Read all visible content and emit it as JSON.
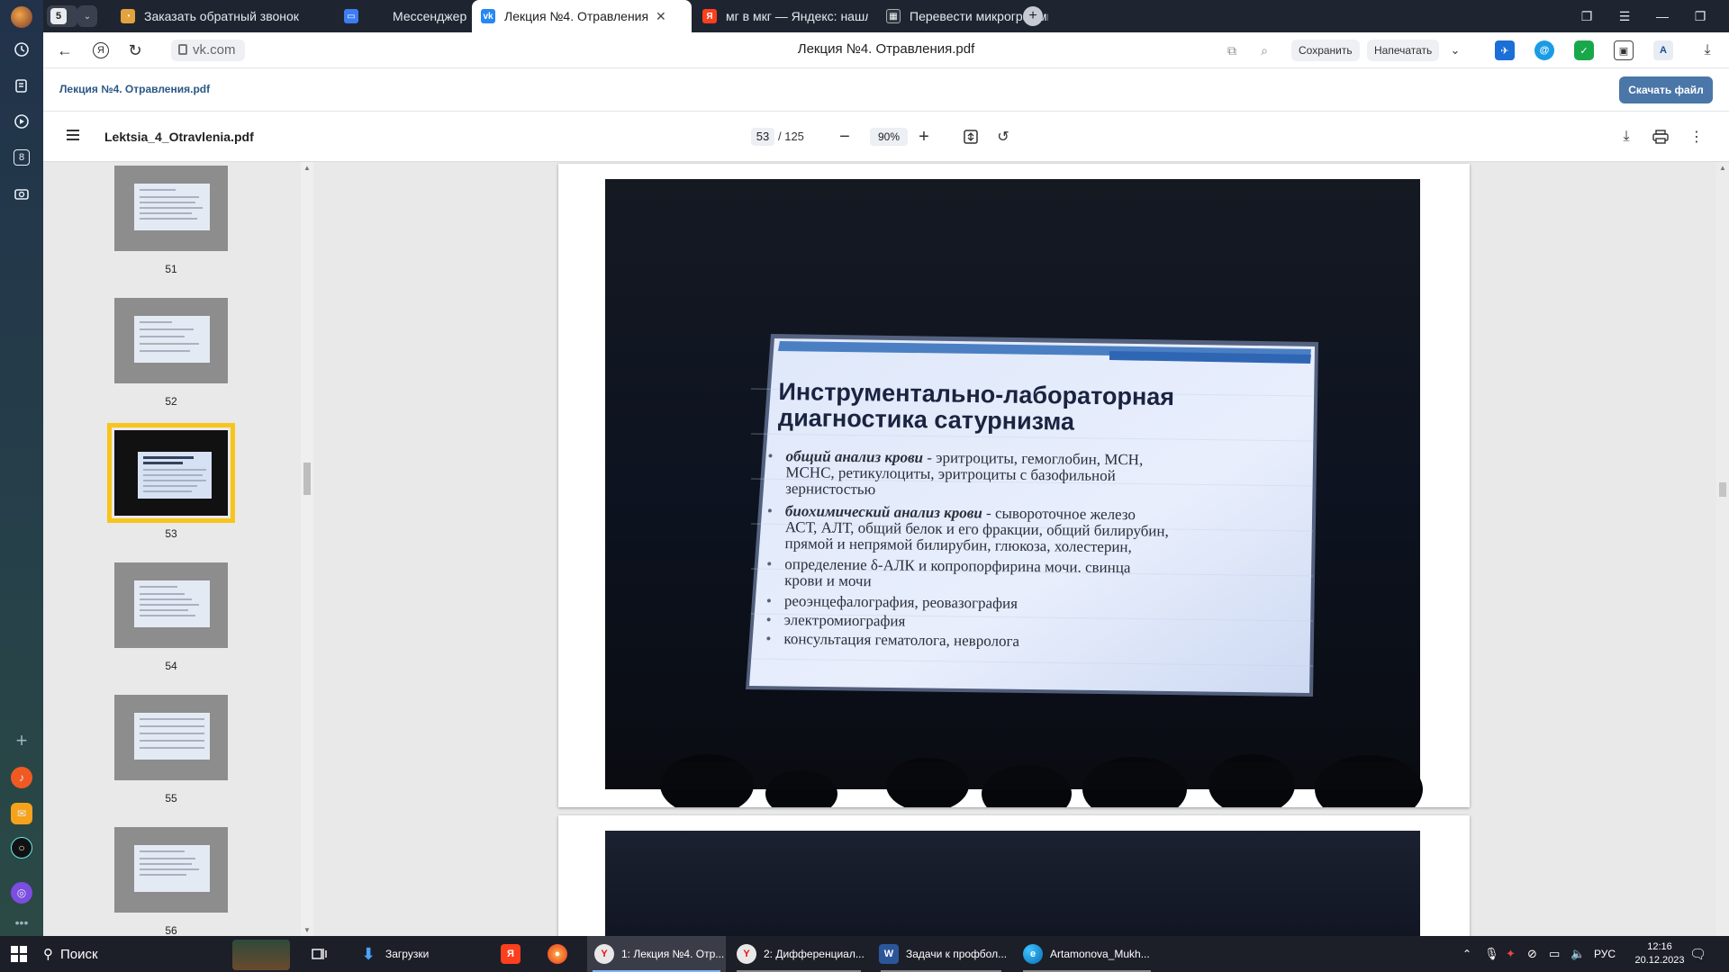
{
  "tabs": [
    {
      "label": "Заказать обратный звонок",
      "icon": "cart-icon"
    },
    {
      "label": "Мессенджер",
      "icon": "messenger-icon"
    },
    {
      "label": "Лекция №4. Отравления",
      "icon": "vk-icon",
      "active": true
    },
    {
      "label": "мг в мкг — Яндекс: нашлось",
      "icon": "yandex-icon"
    },
    {
      "label": "Перевести микрограммы",
      "icon": "converter-icon"
    }
  ],
  "tab_count_badge": "5",
  "address": {
    "domain": "vk.com",
    "title": "Лекция №4. Отравления.pdf",
    "save_label": "Сохранить",
    "print_label": "Напечатать"
  },
  "vk": {
    "doc_title": "Лекция №4. Отравления.pdf",
    "download_label": "Скачать файл"
  },
  "pdf_viewer": {
    "file_name": "Lektsia_4_Otravlenia.pdf",
    "current_page": "53",
    "total_pages": "/ 125",
    "zoom": "90%"
  },
  "thumbnails": [
    {
      "page": "51",
      "dark": false,
      "active": false
    },
    {
      "page": "52",
      "dark": false,
      "active": false
    },
    {
      "page": "53",
      "dark": true,
      "active": true
    },
    {
      "page": "54",
      "dark": false,
      "active": false
    },
    {
      "page": "55",
      "dark": false,
      "active": false
    },
    {
      "page": "56",
      "dark": false,
      "active": false
    }
  ],
  "slide": {
    "title_line1": "Инструментально-лабораторная",
    "title_line2": "диагностика сатурнизма",
    "bullets": [
      {
        "bold": "общий анализ крови",
        "lines": [
          " -  эритроциты,  гемоглобин, МСН,",
          "МСНС, ретикулоциты, эритроциты с базофильной",
          "зернистостью"
        ]
      },
      {
        "bold": "биохимический анализ крови",
        "lines": [
          " - сывороточное железо",
          "АСТ, АЛТ, общий белок и его фракции, общий билирубин,",
          "прямой и непрямой билирубин, глюкоза, холестерин,"
        ]
      },
      {
        "bold": "",
        "lines": [
          "определение δ-АЛК и копропорфирина мочи. свинца",
          "крови и мочи"
        ]
      },
      {
        "bold": "",
        "lines": [
          "реоэнцефалография, реовазография"
        ]
      },
      {
        "bold": "",
        "lines": [
          "электромиография"
        ]
      },
      {
        "bold": "",
        "lines": [
          "консультация гематолога, невролога"
        ]
      }
    ]
  },
  "taskbar": {
    "search_label": "Поиск",
    "items": [
      {
        "label": "Загрузки",
        "icon": "download-folder-icon"
      },
      {
        "label": "",
        "icon": "yandex-browser-icon"
      },
      {
        "label": "",
        "icon": "firefox-icon"
      },
      {
        "label": "1: Лекция №4. Отр...",
        "icon": "yandex-browser-icon",
        "active": true
      },
      {
        "label": "2: Дифференциал...",
        "icon": "yandex-browser-icon"
      },
      {
        "label": "Задачи к профбол...",
        "icon": "word-icon"
      },
      {
        "label": "Artamonova_Mukh...",
        "icon": "edge-icon"
      }
    ],
    "language": "РУС",
    "time": "12:16",
    "date": "20.12.2023"
  },
  "colors": {
    "vk_blue": "#4a76a8",
    "active_thumb_outline": "#f7c51b",
    "tab_strip": "#1f2530"
  }
}
